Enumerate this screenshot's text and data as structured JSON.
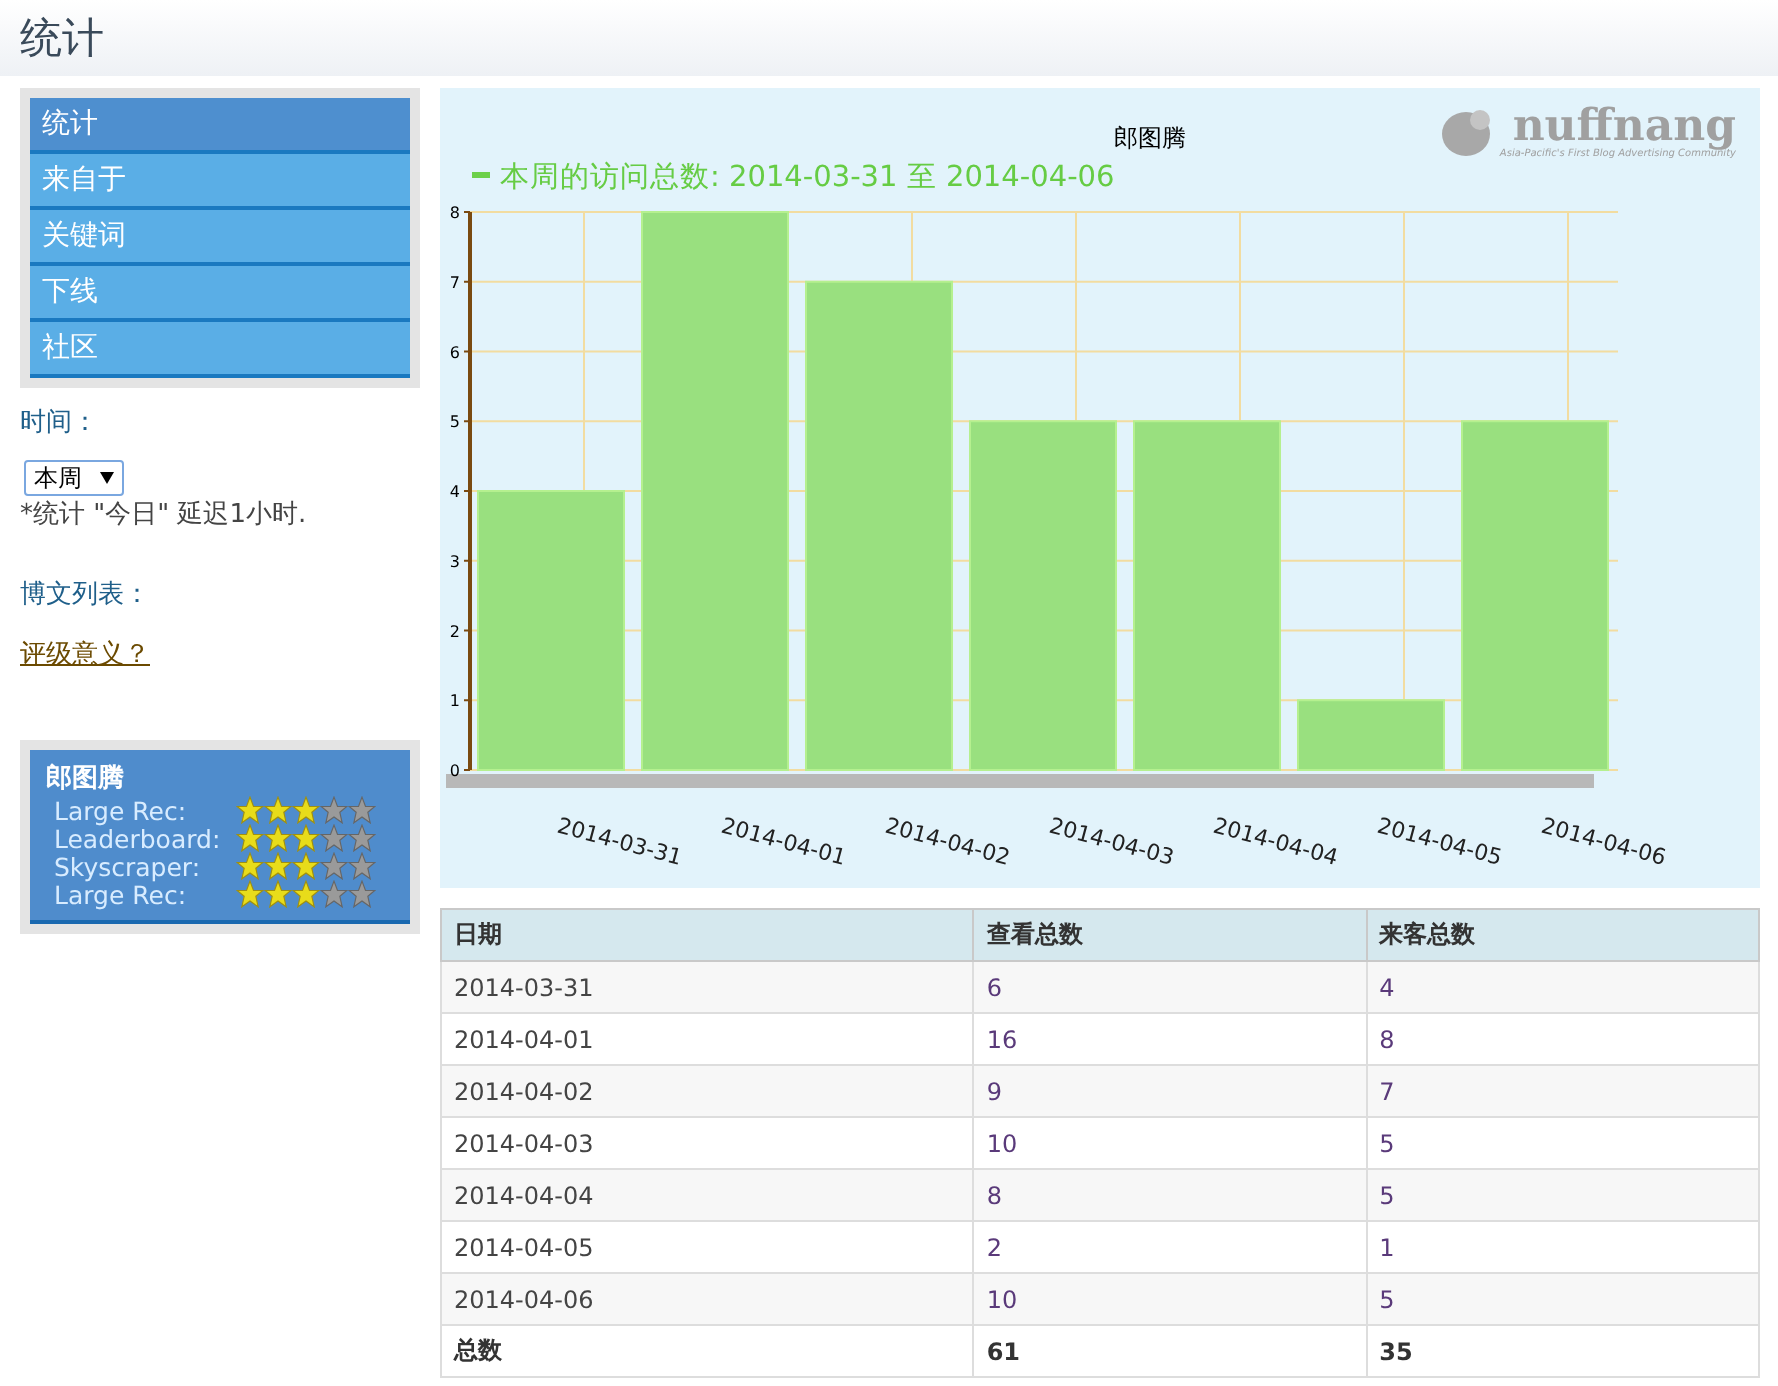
{
  "page_title": "统计",
  "sidebar": {
    "items": [
      {
        "label": "统计",
        "selected": true
      },
      {
        "label": "来自于",
        "selected": false
      },
      {
        "label": "关键词",
        "selected": false
      },
      {
        "label": "下线",
        "selected": false
      },
      {
        "label": "社区",
        "selected": false
      }
    ],
    "time_label": "时间：",
    "period_select": {
      "value": "本周"
    },
    "note": "*统计 \"今日\" 延迟1小时.",
    "posts_label": "博文列表：",
    "rating_link": "评级意义？",
    "rating_card": {
      "name": "郎图腾",
      "ratings": [
        {
          "label": "Large Rec:",
          "stars": 3
        },
        {
          "label": "Leaderboard:",
          "stars": 3
        },
        {
          "label": "Skyscraper:",
          "stars": 3
        },
        {
          "label": "Large Rec:",
          "stars": 3
        }
      ]
    }
  },
  "chart": {
    "logo": "nuffnang",
    "logo_tagline": "Asia-Pacific's First Blog Advertising Community",
    "chart_data": {
      "type": "bar",
      "title": "郎图腾",
      "categories": [
        "2014-03-31",
        "2014-04-01",
        "2014-04-02",
        "2014-04-03",
        "2014-04-04",
        "2014-04-05",
        "2014-04-06"
      ],
      "series": [
        {
          "name": "本周的访问总数: 2014-03-31 至 2014-04-06",
          "color": "#99e07f",
          "values": [
            4,
            8,
            7,
            5,
            5,
            1,
            5
          ]
        }
      ],
      "ylim": [
        0,
        8
      ],
      "grid": true,
      "yticks": [
        0,
        1,
        2,
        3,
        4,
        5,
        6,
        7,
        8
      ]
    }
  },
  "table": {
    "columns": [
      "日期",
      "查看总数",
      "来客总数"
    ],
    "rows": [
      [
        "2014-03-31",
        "6",
        "4"
      ],
      [
        "2014-04-01",
        "16",
        "8"
      ],
      [
        "2014-04-02",
        "9",
        "7"
      ],
      [
        "2014-04-03",
        "10",
        "5"
      ],
      [
        "2014-04-04",
        "8",
        "5"
      ],
      [
        "2014-04-05",
        "2",
        "1"
      ],
      [
        "2014-04-06",
        "10",
        "5"
      ]
    ],
    "total": [
      "总数",
      "61",
      "35"
    ]
  }
}
